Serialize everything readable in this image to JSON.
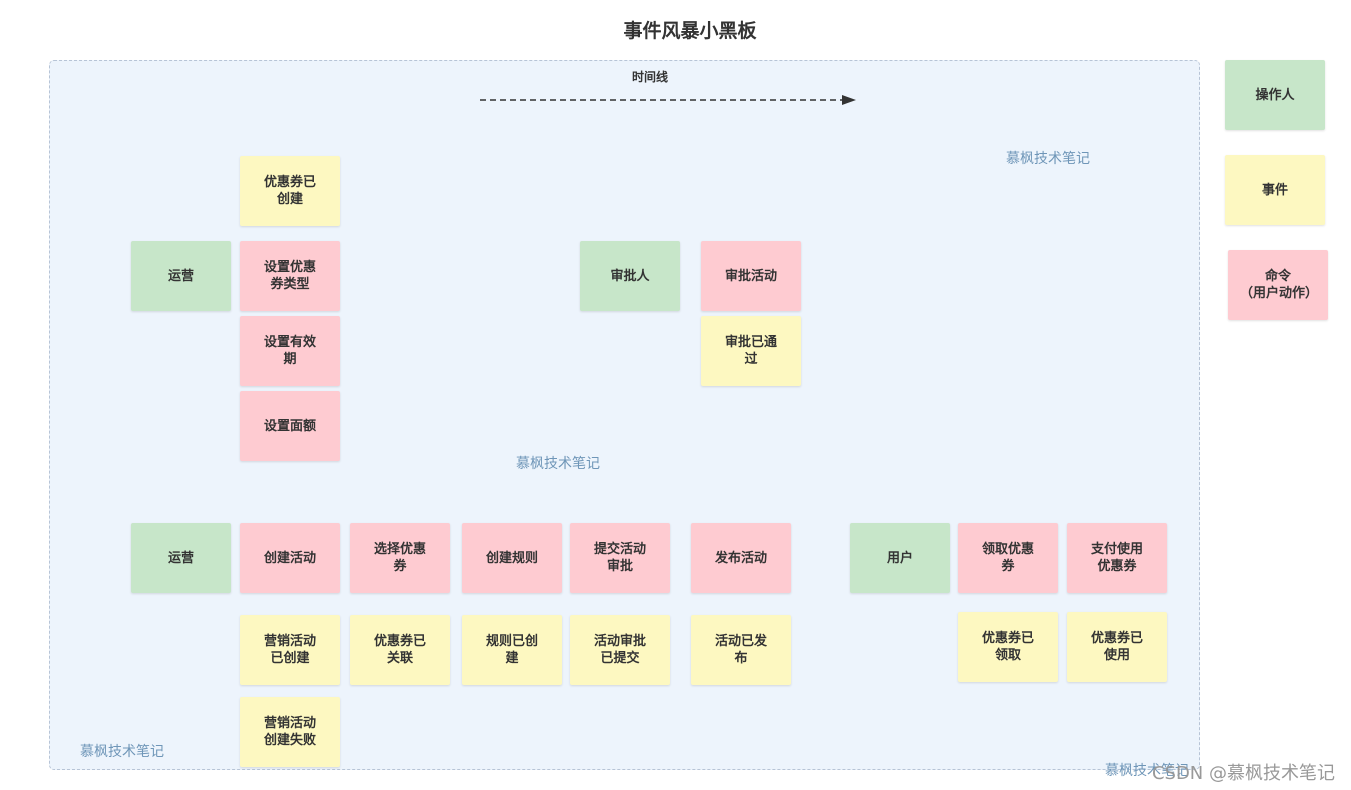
{
  "title": "事件风暴小黑板",
  "timeline_label": "时间线",
  "legend": {
    "actor": "操作人",
    "event": "事件",
    "command": "命令\n（用户动作）"
  },
  "row1": {
    "coupon_created": "优惠券已\n创建",
    "operator": "运营",
    "set_type": "设置优惠\n券类型",
    "set_validity": "设置有效\n期",
    "set_amount": "设置面额",
    "approver": "审批人",
    "approve_activity": "审批活动",
    "approval_passed": "审批已通\n过"
  },
  "row2": {
    "operator": "运营",
    "create_activity": "创建活动",
    "select_coupon": "选择优惠\n券",
    "create_rule": "创建规则",
    "submit_approval": "提交活动\n审批",
    "publish_activity": "发布活动",
    "user": "用户",
    "claim_coupon": "领取优惠\n券",
    "pay_with_coupon": "支付使用\n优惠券",
    "activity_created": "营销活动\n已创建",
    "coupon_linked": "优惠券已\n关联",
    "rule_created": "规则已创\n建",
    "approval_submitted": "活动审批\n已提交",
    "activity_published": "活动已发\n布",
    "coupon_claimed": "优惠券已\n领取",
    "coupon_used": "优惠券已\n使用",
    "activity_create_failed": "营销活动\n创建失败"
  },
  "watermarks": [
    "慕枫技术笔记",
    "慕枫技术笔记",
    "慕枫技术笔记",
    "慕枫技术笔记"
  ],
  "csdn_watermark": "CSDN @慕枫技术笔记",
  "colors": {
    "actor": "#c7e6c9",
    "event": "#fdf8c1",
    "command": "#fecbd1",
    "board": "#edf4fc"
  }
}
